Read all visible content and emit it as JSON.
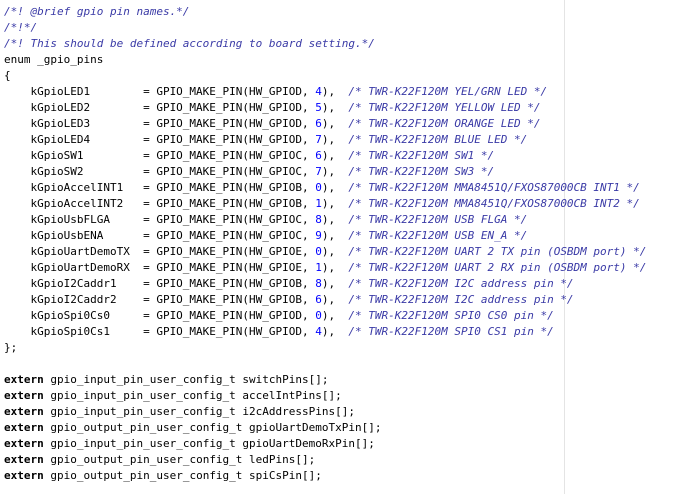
{
  "editor": {
    "lines": [
      [
        {
          "t": "/*! @brief gpio pin names.*/",
          "k": "comment"
        }
      ],
      [
        {
          "t": "/*!*/",
          "k": "comment"
        }
      ],
      [
        {
          "t": "/*! This should be defined according to board setting.*/",
          "k": "comment"
        }
      ],
      [
        {
          "t": "enum _gpio_pins",
          "k": "id"
        }
      ],
      [
        {
          "t": "{",
          "k": "punc"
        }
      ],
      [
        {
          "t": "    kGpioLED1        = GPIO_MAKE_PIN(HW_GPIOD, ",
          "k": "id"
        },
        {
          "t": "4",
          "k": "num"
        },
        {
          "t": "),  ",
          "k": "punc"
        },
        {
          "t": "/* TWR-K22F120M YEL/GRN LED */",
          "k": "comment"
        }
      ],
      [
        {
          "t": "    kGpioLED2        = GPIO_MAKE_PIN(HW_GPIOD, ",
          "k": "id"
        },
        {
          "t": "5",
          "k": "num"
        },
        {
          "t": "),  ",
          "k": "punc"
        },
        {
          "t": "/* TWR-K22F120M YELLOW LED */",
          "k": "comment"
        }
      ],
      [
        {
          "t": "    kGpioLED3        = GPIO_MAKE_PIN(HW_GPIOD, ",
          "k": "id"
        },
        {
          "t": "6",
          "k": "num"
        },
        {
          "t": "),  ",
          "k": "punc"
        },
        {
          "t": "/* TWR-K22F120M ORANGE LED */",
          "k": "comment"
        }
      ],
      [
        {
          "t": "    kGpioLED4        = GPIO_MAKE_PIN(HW_GPIOD, ",
          "k": "id"
        },
        {
          "t": "7",
          "k": "num"
        },
        {
          "t": "),  ",
          "k": "punc"
        },
        {
          "t": "/* TWR-K22F120M BLUE LED */",
          "k": "comment"
        }
      ],
      [
        {
          "t": "    kGpioSW1         = GPIO_MAKE_PIN(HW_GPIOC, ",
          "k": "id"
        },
        {
          "t": "6",
          "k": "num"
        },
        {
          "t": "),  ",
          "k": "punc"
        },
        {
          "t": "/* TWR-K22F120M SW1 */",
          "k": "comment"
        }
      ],
      [
        {
          "t": "    kGpioSW2         = GPIO_MAKE_PIN(HW_GPIOC, ",
          "k": "id"
        },
        {
          "t": "7",
          "k": "num"
        },
        {
          "t": "),  ",
          "k": "punc"
        },
        {
          "t": "/* TWR-K22F120M SW3 */",
          "k": "comment"
        }
      ],
      [
        {
          "t": "    kGpioAccelINT1   = GPIO_MAKE_PIN(HW_GPIOB, ",
          "k": "id"
        },
        {
          "t": "0",
          "k": "num"
        },
        {
          "t": "),  ",
          "k": "punc"
        },
        {
          "t": "/* TWR-K22F120M MMA8451Q/FXOS87000CB INT1 */",
          "k": "comment"
        }
      ],
      [
        {
          "t": "    kGpioAccelINT2   = GPIO_MAKE_PIN(HW_GPIOB, ",
          "k": "id"
        },
        {
          "t": "1",
          "k": "num"
        },
        {
          "t": "),  ",
          "k": "punc"
        },
        {
          "t": "/* TWR-K22F120M MMA8451Q/FXOS87000CB INT2 */",
          "k": "comment"
        }
      ],
      [
        {
          "t": "    kGpioUsbFLGA     = GPIO_MAKE_PIN(HW_GPIOC, ",
          "k": "id"
        },
        {
          "t": "8",
          "k": "num"
        },
        {
          "t": "),  ",
          "k": "punc"
        },
        {
          "t": "/* TWR-K22F120M USB FLGA */",
          "k": "comment"
        }
      ],
      [
        {
          "t": "    kGpioUsbENA      = GPIO_MAKE_PIN(HW_GPIOC, ",
          "k": "id"
        },
        {
          "t": "9",
          "k": "num"
        },
        {
          "t": "),  ",
          "k": "punc"
        },
        {
          "t": "/* TWR-K22F120M USB EN_A */",
          "k": "comment"
        }
      ],
      [
        {
          "t": "    kGpioUartDemoTX  = GPIO_MAKE_PIN(HW_GPIOE, ",
          "k": "id"
        },
        {
          "t": "0",
          "k": "num"
        },
        {
          "t": "),  ",
          "k": "punc"
        },
        {
          "t": "/* TWR-K22F120M UART 2 TX pin (OSBDM port) */",
          "k": "comment"
        }
      ],
      [
        {
          "t": "    kGpioUartDemoRX  = GPIO_MAKE_PIN(HW_GPIOE, ",
          "k": "id"
        },
        {
          "t": "1",
          "k": "num"
        },
        {
          "t": "),  ",
          "k": "punc"
        },
        {
          "t": "/* TWR-K22F120M UART 2 RX pin (OSBDM port) */",
          "k": "comment"
        }
      ],
      [
        {
          "t": "    kGpioI2Caddr1    = GPIO_MAKE_PIN(HW_GPIOB, ",
          "k": "id"
        },
        {
          "t": "8",
          "k": "num"
        },
        {
          "t": "),  ",
          "k": "punc"
        },
        {
          "t": "/* TWR-K22F120M I2C address pin */",
          "k": "comment"
        }
      ],
      [
        {
          "t": "    kGpioI2Caddr2    = GPIO_MAKE_PIN(HW_GPIOB, ",
          "k": "id"
        },
        {
          "t": "6",
          "k": "num"
        },
        {
          "t": "),  ",
          "k": "punc"
        },
        {
          "t": "/* TWR-K22F120M I2C address pin */",
          "k": "comment"
        }
      ],
      [
        {
          "t": "    kGpioSpi0Cs0     = GPIO_MAKE_PIN(HW_GPIOD, ",
          "k": "id"
        },
        {
          "t": "0",
          "k": "num"
        },
        {
          "t": "),  ",
          "k": "punc"
        },
        {
          "t": "/* TWR-K22F120M SPI0 CS0 pin */",
          "k": "comment"
        }
      ],
      [
        {
          "t": "    kGpioSpi0Cs1     = GPIO_MAKE_PIN(HW_GPIOD, ",
          "k": "id"
        },
        {
          "t": "4",
          "k": "num"
        },
        {
          "t": "),  ",
          "k": "punc"
        },
        {
          "t": "/* TWR-K22F120M SPI0 CS1 pin */",
          "k": "comment"
        }
      ],
      [
        {
          "t": "};",
          "k": "punc"
        }
      ],
      [],
      [
        {
          "t": "extern",
          "k": "kw"
        },
        {
          "t": " gpio_input_pin_user_config_t switchPins[];",
          "k": "id"
        }
      ],
      [
        {
          "t": "extern",
          "k": "kw"
        },
        {
          "t": " gpio_input_pin_user_config_t accelIntPins[];",
          "k": "id"
        }
      ],
      [
        {
          "t": "extern",
          "k": "kw"
        },
        {
          "t": " gpio_input_pin_user_config_t i2cAddressPins[];",
          "k": "id"
        }
      ],
      [
        {
          "t": "extern",
          "k": "kw"
        },
        {
          "t": " gpio_output_pin_user_config_t gpioUartDemoTxPin[];",
          "k": "id"
        }
      ],
      [
        {
          "t": "extern",
          "k": "kw"
        },
        {
          "t": " gpio_input_pin_user_config_t gpioUartDemoRxPin[];",
          "k": "id"
        }
      ],
      [
        {
          "t": "extern",
          "k": "kw"
        },
        {
          "t": " gpio_output_pin_user_config_t ledPins[];",
          "k": "id"
        }
      ],
      [
        {
          "t": "extern",
          "k": "kw"
        },
        {
          "t": " gpio_output_pin_user_config_t spiCsPin[];",
          "k": "id"
        }
      ]
    ]
  }
}
